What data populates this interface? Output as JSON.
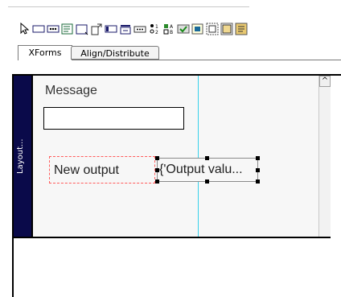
{
  "toolbar": {
    "icons": [
      "pointer-icon",
      "input-icon",
      "secret-icon",
      "textarea-icon",
      "upload-icon",
      "output-icon",
      "button-icon",
      "range-icon",
      "submit-icon",
      "select1-icon",
      "select-icon",
      "trigger-icon",
      "group-icon",
      "switch-icon",
      "repeat-icon",
      "label-icon"
    ]
  },
  "tabs": {
    "xforms": "XForms",
    "align": "Align/Distribute"
  },
  "editor": {
    "layout_label": "Layout...",
    "message_label": "Message",
    "message_value": "",
    "new_output_label": "New output",
    "output_value_label": "{'Output valu...",
    "scroll_up_arrow": "^"
  },
  "colors": {
    "layout_bar": "#0a0a4a",
    "guide_line": "#35d0ea",
    "selection_dash": "#ff5c5c"
  }
}
